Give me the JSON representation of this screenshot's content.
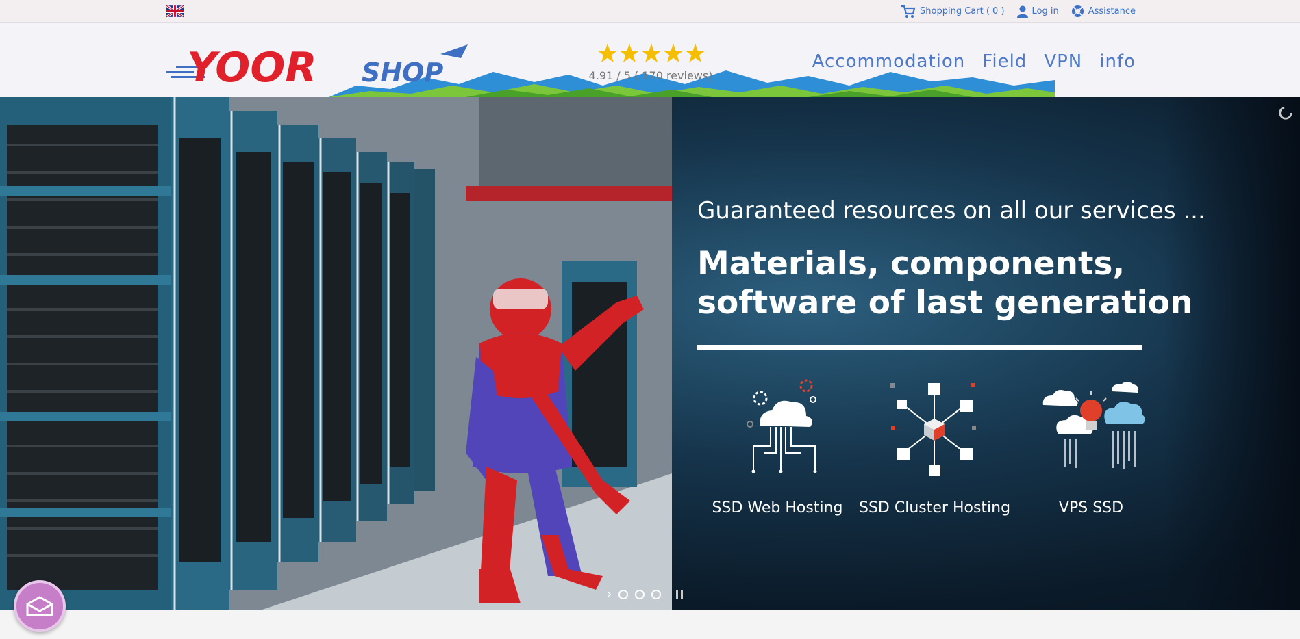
{
  "topbar": {
    "language_flag": "uk-flag-icon",
    "cart_label": "Shopping Cart ( 0 )",
    "login_label": "Log in",
    "assistance_label": "Assistance"
  },
  "header": {
    "logo_text_part1": "YOOR",
    "logo_text_part2": "SHOP",
    "stars": "★★★★★",
    "rating_text": "4.91 / 5 ( 170 reviews)",
    "nav": [
      "Accommodation",
      "Field",
      "VPN",
      "info"
    ]
  },
  "hero": {
    "tagline": "Guaranteed resources on all our services ...",
    "headline_line1": "Materials, components,",
    "headline_line2": "software of last generation",
    "services": [
      {
        "label": "SSD Web Hosting",
        "icon": "cloud-network-icon"
      },
      {
        "label": "SSD Cluster Hosting",
        "icon": "cluster-cube-icon"
      },
      {
        "label": "VPS SSD",
        "icon": "cloud-bulb-icon"
      }
    ],
    "slider_next": "›",
    "slides_count": 3
  },
  "colors": {
    "accent_blue": "#4e79c7",
    "link_blue": "#3b73c6",
    "star_gold": "#f6be00",
    "mail_button": "#c67ec9"
  }
}
